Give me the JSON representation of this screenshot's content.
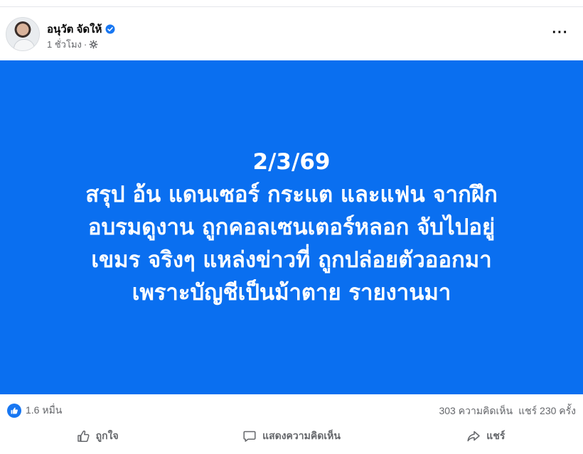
{
  "post": {
    "author": "อนุวัต จัดให้",
    "time": "1 ชั่วโมง",
    "separator": "·",
    "more_label": "···",
    "content": "2/3/69\nสรุป อ้น แดนเซอร์ กระแต และแฟน จากฝึก\nอบรมดูงาน ถูกคอลเซนเตอร์หลอก จับไปอยู่\nเขมร จริงๆ แหล่งข่าวที่ ถูกปล่อยตัวออกมา\nเพราะบัญชีเป็นม้าตาย รายงานมา",
    "background_color": "#0a6ff0"
  },
  "stats": {
    "reactions": "1.6 หมื่น",
    "comments": "303 ความคิดเห็น",
    "shares": "แชร์ 230 ครั้ง"
  },
  "actions": {
    "like_label": "ถูกใจ",
    "comment_label": "แสดงความคิดเห็น",
    "share_label": "แชร์"
  },
  "icons": {
    "verified": "verified-badge-icon",
    "privacy": "gear-icon",
    "reaction": "thumbs-up-icon",
    "like": "thumbs-up-outline-icon",
    "comment": "speech-bubble-icon",
    "share": "share-arrow-icon"
  },
  "colors": {
    "accent": "#1877f2",
    "secondary_text": "#65676b"
  }
}
